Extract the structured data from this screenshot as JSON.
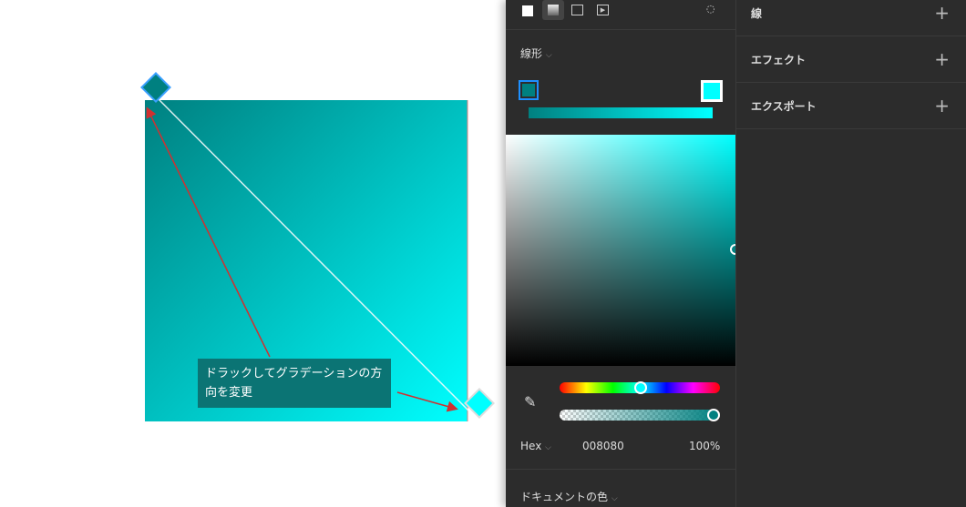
{
  "canvas": {
    "annotation": "ドラックしてグラデーションの方向を変更",
    "gradient_start": "#008080",
    "gradient_end": "#00ffff",
    "arrow_color": "#d03030"
  },
  "panel": {
    "fill_types": [
      "solid-icon",
      "gradient-icon",
      "image-icon",
      "video-icon"
    ],
    "opacity_icon": "drop-icon",
    "gradient_type": "線形",
    "stops": [
      "#008080",
      "#00ffff"
    ],
    "hex_mode": "Hex",
    "hex_value": "008080",
    "opacity": "100%",
    "document_colors": "ドキュメントの色",
    "hue_position": 0.5,
    "alpha_position": 1.0
  },
  "right": {
    "sections": [
      {
        "label": "線"
      },
      {
        "label": "エフェクト"
      },
      {
        "label": "エクスポート"
      }
    ],
    "add": "+"
  }
}
